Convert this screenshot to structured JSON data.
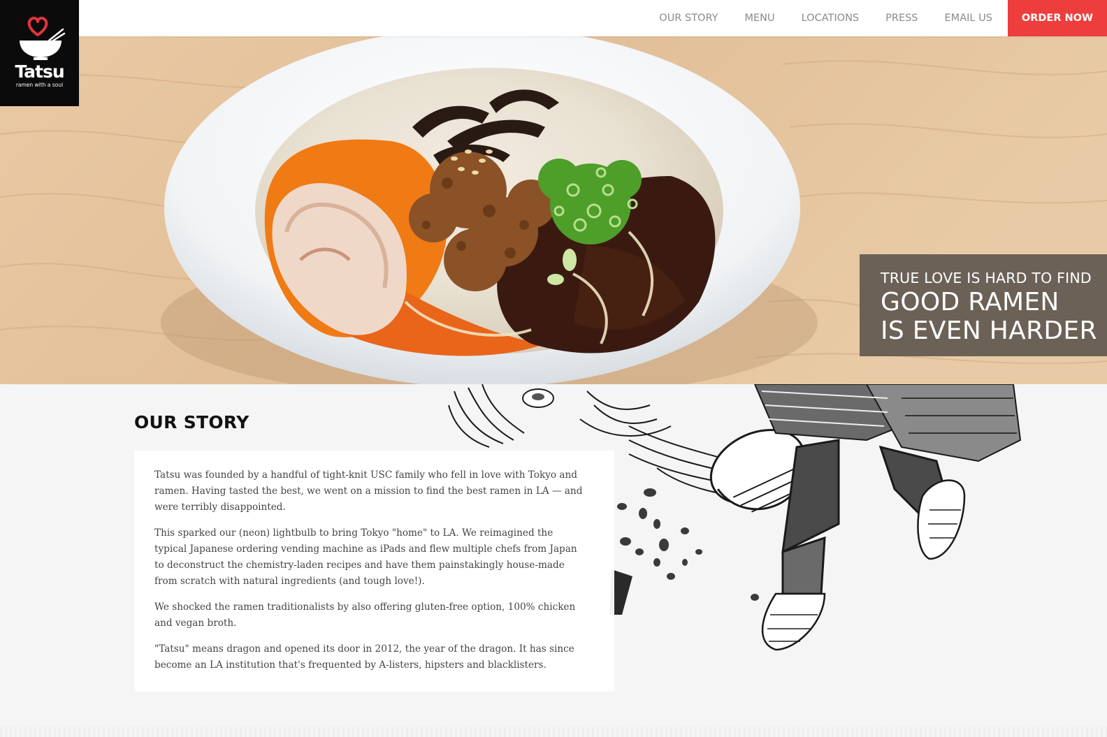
{
  "brand": {
    "name": "Tatsu",
    "tagline": "ramen with a soul",
    "accent": "#ee3d3d"
  },
  "nav": {
    "items": [
      {
        "label": "OUR STORY"
      },
      {
        "label": "MENU"
      },
      {
        "label": "LOCATIONS"
      },
      {
        "label": "PRESS"
      },
      {
        "label": "EMAIL US"
      }
    ],
    "cta": "ORDER NOW"
  },
  "hero": {
    "line1": "TRUE LOVE IS HARD TO FIND",
    "line2": "GOOD RAMEN",
    "line3": "IS EVEN HARDER",
    "image": "ramen-bowl-photo"
  },
  "story": {
    "title": "OUR STORY",
    "paragraphs": [
      "Tatsu was founded by a handful of tight-knit USC family who fell in love with Tokyo and ramen. Having tasted the best, we went on a mission to find the best ramen in LA — and were terribly disappointed.",
      "This sparked our (neon) lightbulb to bring Tokyo \"home\" to LA. We reimagined the typical Japanese ordering vending machine as iPads and flew multiple chefs from Japan to deconstruct the chemistry-laden recipes and have them painstakingly house-made from scratch with natural ingredients (and tough love!).",
      "We shocked the ramen traditionalists by also offering gluten-free option, 100% chicken and vegan broth.",
      "\"Tatsu\" means dragon and opened its door in 2012, the year of the dragon. It has since become an LA institution that's frequented by A-listers, hipsters and blacklisters."
    ],
    "illustration": "samurai-ramen-illustration"
  }
}
